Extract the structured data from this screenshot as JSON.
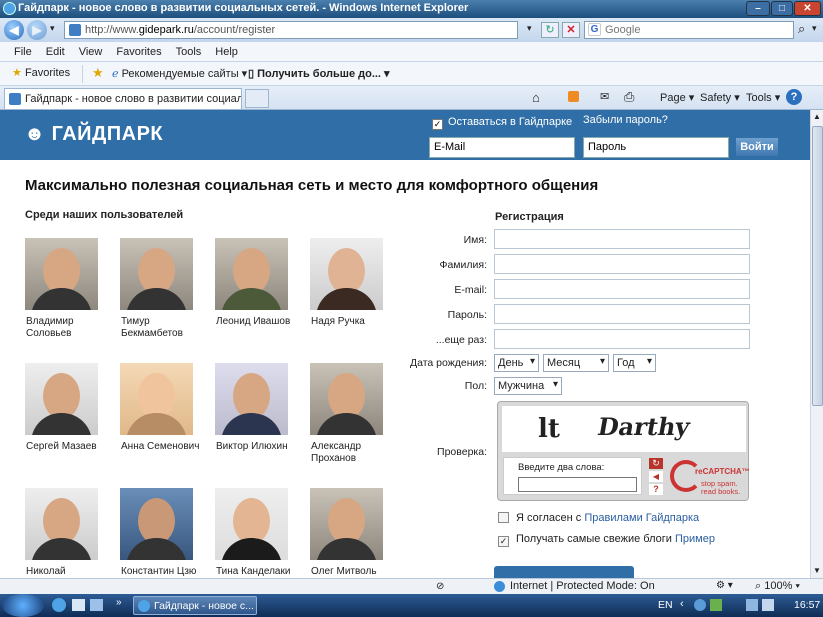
{
  "window": {
    "title": "Гайдпарк - новое слово в развитии социальных сетей. - Windows Internet Explorer",
    "min": "–",
    "max": "□",
    "close": "✕"
  },
  "nav": {
    "url_prefix": "http://www.",
    "url_domain": "gidepark.ru",
    "url_path": "/account/register",
    "search_placeholder": "Google"
  },
  "menu": [
    "File",
    "Edit",
    "View",
    "Favorites",
    "Tools",
    "Help"
  ],
  "favbar": {
    "favorites": "Favorites",
    "suggested": "Рекомендуемые сайты ▾",
    "more": "Получить больше до... ▾"
  },
  "tab": {
    "label": "Гайдпарк - новое слово в развитии социальны..."
  },
  "commandbar": {
    "page": "Page ▾",
    "safety": "Safety ▾",
    "tools": "Tools ▾",
    "help": "?"
  },
  "header": {
    "logo": "ГАЙДПАРК",
    "remember": "Оставаться в Гайдпарке",
    "forgot": "Забыли пароль?",
    "email_value": "E-Mail",
    "password_value": "Пароль",
    "login_button": "Войти"
  },
  "headline": "Максимально полезная социальная сеть и место для комфортного общения",
  "users_heading": "Среди наших пользователей",
  "users": [
    {
      "name": "Владимир Соловьев"
    },
    {
      "name": "Тимур Бекмамбетов"
    },
    {
      "name": "Леонид Ивашов"
    },
    {
      "name": "Надя Ручка"
    },
    {
      "name": "Сергей Мазаев"
    },
    {
      "name": "Анна Семенович"
    },
    {
      "name": "Виктор Илюхин"
    },
    {
      "name": "Александр Проханов"
    },
    {
      "name": "Николай"
    },
    {
      "name": "Константин Цзю"
    },
    {
      "name": "Тина Канделаки"
    },
    {
      "name": "Олег Митволь"
    }
  ],
  "registration": {
    "title": "Регистрация",
    "fields": {
      "name": "Имя:",
      "surname": "Фамилия:",
      "email": "E-mail:",
      "password": "Пароль:",
      "password2": "...еще раз:"
    },
    "dob_label": "Дата рождения:",
    "day": "День",
    "month": "Месяц",
    "year": "Год",
    "gender_label": "Пол:",
    "gender_value": "Мужчина",
    "check_label": "Проверка:",
    "captcha_word1": "lt",
    "captcha_word2": "Darthy",
    "captcha_prompt": "Введите два слова:",
    "recaptcha_brand": "reCAPTCHA™",
    "recaptcha_tag1": "stop spam.",
    "recaptcha_tag2": "read books.",
    "agree_prefix": "Я согласен с ",
    "agree_link": "Правилами Гайдпарка",
    "subscribe_prefix": "Получать самые свежие блоги ",
    "subscribe_link": "Пример"
  },
  "status": {
    "zone": "Internet | Protected Mode: On",
    "zoom": "100% ▾"
  },
  "taskbar": {
    "item": "Гайдпарк - новое с...",
    "lang": "EN",
    "time": "16:57"
  }
}
